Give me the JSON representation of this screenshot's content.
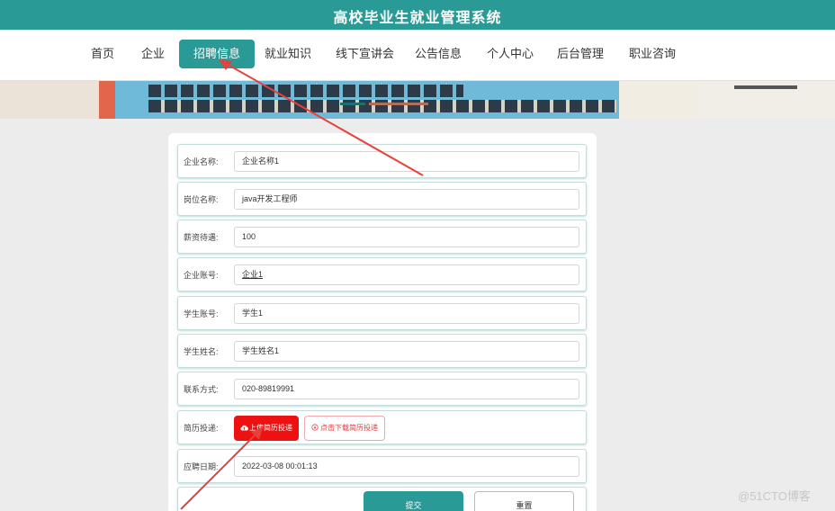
{
  "header": {
    "title": "高校毕业生就业管理系统"
  },
  "nav": {
    "items": [
      {
        "label": "首页"
      },
      {
        "label": "企业"
      },
      {
        "label": "招聘信息",
        "active": true
      },
      {
        "label": "就业知识"
      },
      {
        "label": "线下宣讲会"
      },
      {
        "label": "公告信息"
      },
      {
        "label": "个人中心"
      },
      {
        "label": "后台管理"
      },
      {
        "label": "职业咨询"
      }
    ]
  },
  "form": {
    "fields": [
      {
        "label": "企业名称:",
        "value": "企业名称1"
      },
      {
        "label": "岗位名称:",
        "value": "java开发工程师"
      },
      {
        "label": "薪资待遇:",
        "value": "100"
      },
      {
        "label": "企业账号:",
        "value": "企业1"
      },
      {
        "label": "学生账号:",
        "value": "学生1"
      },
      {
        "label": "学生姓名:",
        "value": "学生姓名1"
      },
      {
        "label": "联系方式:",
        "value": "020-89819991"
      }
    ],
    "resume": {
      "label": "简历投递:",
      "upload_label": "上传简历投递",
      "download_label": "点击下载简历投递"
    },
    "date": {
      "label": "应聘日期:",
      "value": "2022-03-08 00:01:13"
    },
    "submit_label": "提交",
    "reset_label": "重置"
  },
  "watermark": "@51CTO博客",
  "colors": {
    "primary": "#2a9a96",
    "upload_button": "#ee1111",
    "annotation_arrow": "#e8403a"
  }
}
